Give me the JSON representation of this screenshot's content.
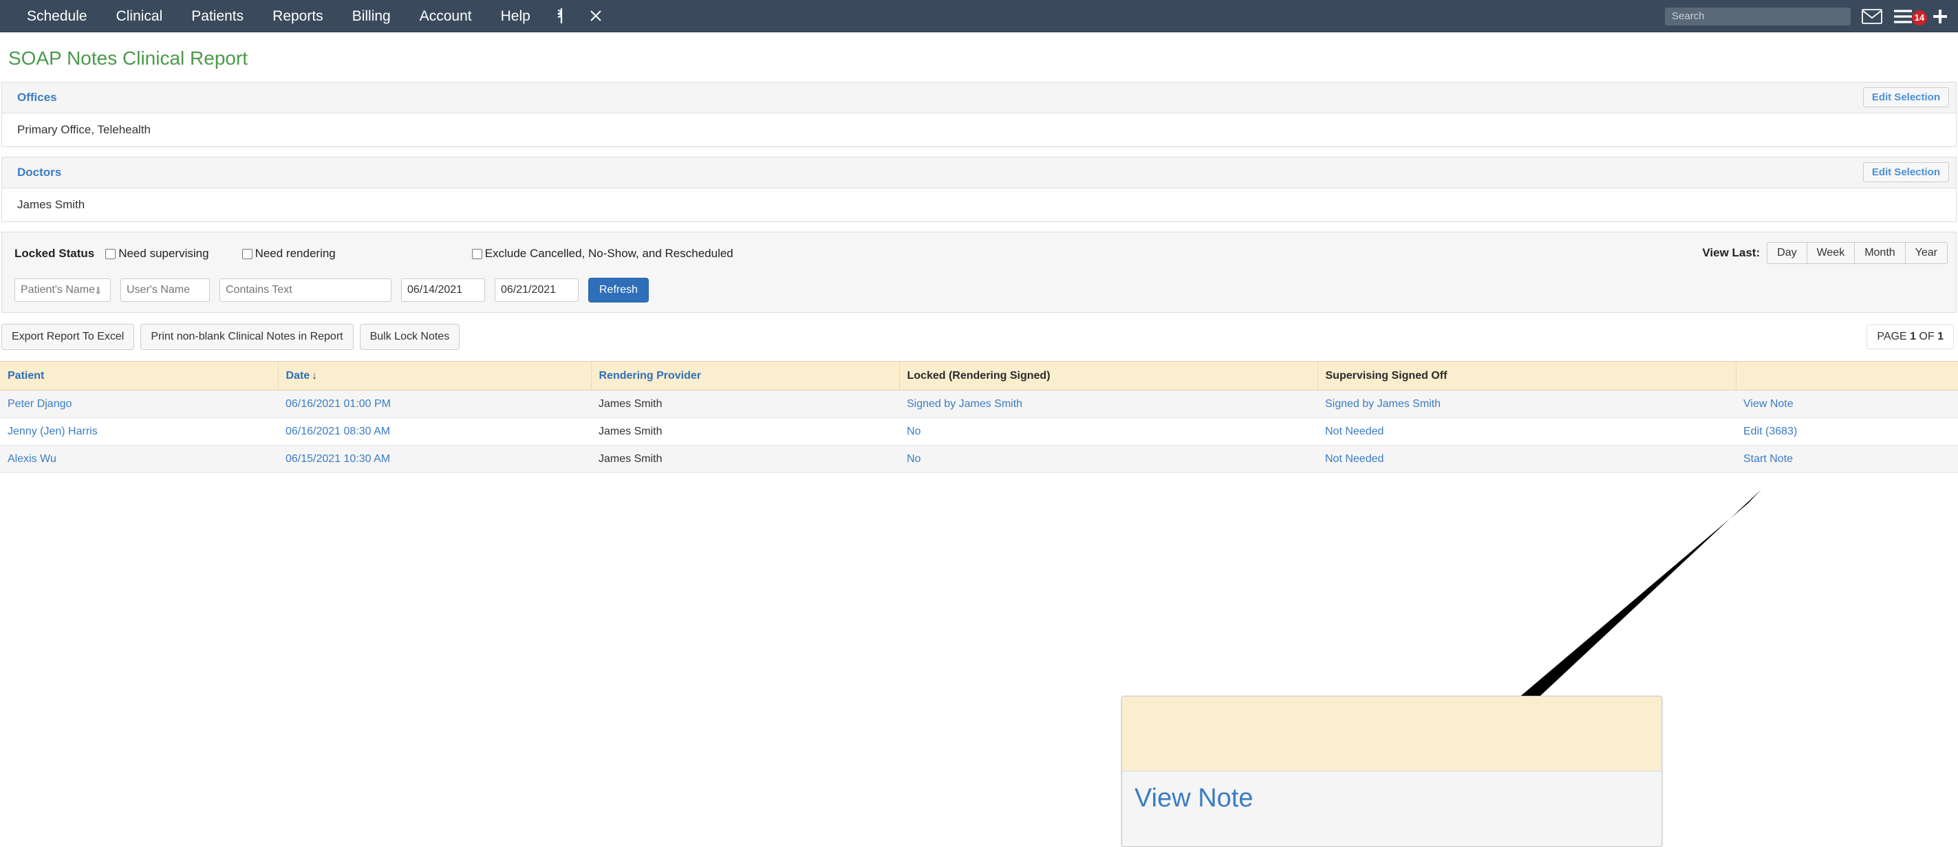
{
  "topnav": {
    "items": [
      {
        "label": "Schedule",
        "name": "nav-item-schedule"
      },
      {
        "label": "Clinical",
        "name": "nav-item-clinical"
      },
      {
        "label": "Patients",
        "name": "nav-item-patients"
      },
      {
        "label": "Reports",
        "name": "nav-item-reports"
      },
      {
        "label": "Billing",
        "name": "nav-item-billing"
      },
      {
        "label": "Account",
        "name": "nav-item-account"
      },
      {
        "label": "Help",
        "name": "nav-item-help"
      }
    ],
    "caduceus_icon": "caduceus-icon",
    "close_icon": "close-icon",
    "search": {
      "value": "",
      "placeholder": "Search"
    },
    "mail_icon": "envelope-icon",
    "menu_icon": "hamburger-menu-icon",
    "notification_count": "14",
    "add_icon": "plus-icon",
    "bar_color": "#3a4a5c",
    "badge_color": "#cc2229"
  },
  "page": {
    "title": "SOAP Notes Clinical Report",
    "title_color": "#4a9a4a"
  },
  "offices_panel": {
    "heading": "Offices",
    "edit_button": "Edit Selection",
    "value": "Primary Office, Telehealth"
  },
  "doctors_panel": {
    "heading": "Doctors",
    "edit_button": "Edit Selection",
    "value": "James Smith"
  },
  "filters": {
    "locked_status_label": "Locked Status",
    "need_supervising_label": "Need supervising",
    "need_rendering_label": "Need rendering",
    "exclude_label": "Exclude Cancelled, No-Show, and Rescheduled",
    "need_supervising_checked": false,
    "need_rendering_checked": false,
    "exclude_checked": false,
    "view_last_label": "View Last:",
    "view_last_options": [
      "Day",
      "Week",
      "Month",
      "Year"
    ],
    "patient_name": {
      "value": "",
      "placeholder": "Patient's Name"
    },
    "user_name": {
      "value": "",
      "placeholder": "User's Name"
    },
    "contains_text": {
      "value": "",
      "placeholder": "Contains Text"
    },
    "date_from": "06/14/2021",
    "date_to": "06/21/2021",
    "refresh_label": "Refresh",
    "refresh_color": "#2f6fba"
  },
  "actions": {
    "export_label": "Export Report To Excel",
    "print_label": "Print non-blank Clinical Notes in Report",
    "bulk_lock_label": "Bulk Lock Notes",
    "page_prefix": "PAGE",
    "page_current": "1",
    "page_of": "OF",
    "page_total": "1"
  },
  "table": {
    "header_bg": "#faeece",
    "columns": [
      {
        "label": "Patient",
        "name": "col-header-patient"
      },
      {
        "label": "Date",
        "name": "col-header-date",
        "sort": "↓"
      },
      {
        "label": "Rendering Provider",
        "name": "col-header-rendering-provider"
      },
      {
        "label": "Locked (Rendering Signed)",
        "name": "col-header-locked"
      },
      {
        "label": "Supervising Signed Off",
        "name": "col-header-supervising"
      },
      {
        "label": "",
        "name": "col-header-action"
      }
    ],
    "rows": [
      {
        "patient": "Peter Django",
        "date": "06/16/2021 01:00 PM",
        "provider": "James Smith",
        "locked": "Signed by James Smith",
        "supervising": "Signed by James Smith",
        "action": "View Note"
      },
      {
        "patient": "Jenny (Jen) Harris",
        "date": "06/16/2021 08:30 AM",
        "provider": "James Smith",
        "locked": "No",
        "supervising": "Not Needed",
        "action": "Edit (3683)"
      },
      {
        "patient": "Alexis Wu",
        "date": "06/15/2021 10:30 AM",
        "provider": "James Smith",
        "locked": "No",
        "supervising": "Not Needed",
        "action": "Start Note"
      }
    ]
  },
  "annotation": {
    "arrow_icon": "arrow-pointer",
    "callout_link": "View Note"
  }
}
